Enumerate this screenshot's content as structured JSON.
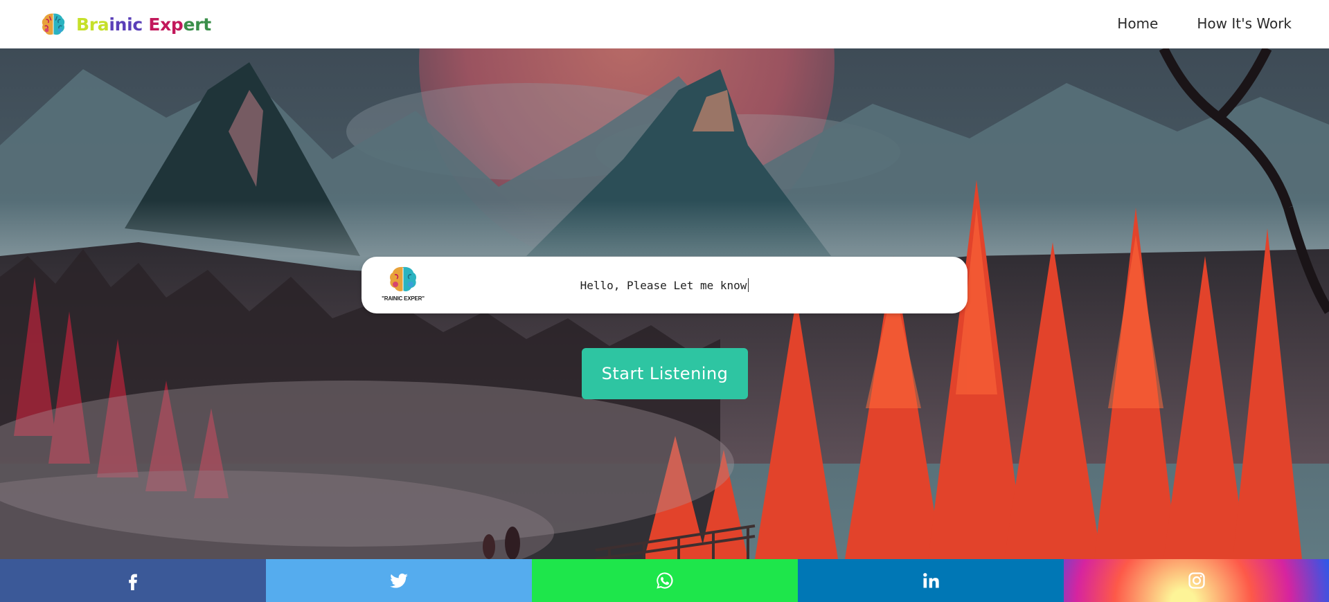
{
  "navbar": {
    "brand_segments": [
      "Bra",
      "inic ",
      "Exp",
      "ert"
    ],
    "links": [
      "Home",
      "How It's Work"
    ]
  },
  "hero": {
    "speech_logo_text": "\"RAINIC EXPER\"",
    "speech_text": "Hello, Please Let me know",
    "button_label": "Start Listening"
  },
  "social": [
    {
      "name": "facebook",
      "icon": "facebook-icon",
      "color": "#3b5998"
    },
    {
      "name": "twitter",
      "icon": "twitter-icon",
      "color": "#55acee"
    },
    {
      "name": "whatsapp",
      "icon": "whatsapp-icon",
      "color": "#1ee64b"
    },
    {
      "name": "linkedin",
      "icon": "linkedin-icon",
      "color": "#0077b5"
    },
    {
      "name": "instagram",
      "icon": "instagram-icon",
      "color": "gradient"
    }
  ],
  "colors": {
    "accent_button": "#2ec5a2",
    "brand_lime": "#c6e02a",
    "brand_purple": "#5a3fb8",
    "brand_magenta": "#c2185b",
    "brand_green": "#3a8f4a"
  }
}
